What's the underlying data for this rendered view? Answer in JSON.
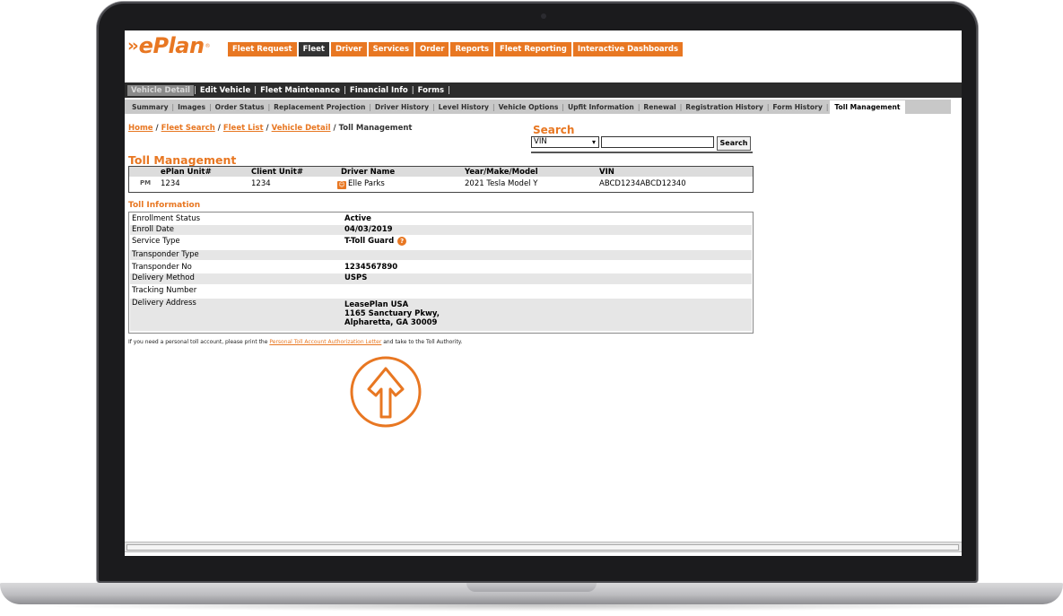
{
  "brand": {
    "chevrons": "››",
    "name": "ePlan",
    "mark": "®"
  },
  "top_nav": [
    {
      "label": "Fleet Request"
    },
    {
      "label": "Fleet"
    },
    {
      "label": "Driver"
    },
    {
      "label": "Services"
    },
    {
      "label": "Order"
    },
    {
      "label": "Reports"
    },
    {
      "label": "Fleet Reporting"
    },
    {
      "label": "Interactive Dashboards"
    }
  ],
  "top_nav_active": "Fleet",
  "sub_nav": [
    "Vehicle Detail",
    "Edit Vehicle",
    "Fleet Maintenance",
    "Financial Info",
    "Forms"
  ],
  "sub_nav_separator": "|",
  "tabs": [
    "Summary",
    "Images",
    "Order Status",
    "Replacement Projection",
    "Driver History",
    "Level History",
    "Vehicle Options",
    "Upfit Information",
    "Renewal",
    "Registration History",
    "Form History",
    "Toll Management"
  ],
  "breadcrumb": {
    "home": "Home",
    "fleet_search": "Fleet Search",
    "fleet_list": "Fleet List",
    "vehicle_detail": "Vehicle Detail",
    "current": "Toll Management",
    "sep": " / "
  },
  "search": {
    "title": "Search",
    "type_value": "VIN",
    "caret": "▾",
    "input_value": "",
    "button": "Search"
  },
  "toll_title": "Toll Management",
  "unit_table": {
    "headers": {
      "eplan_unit": "ePlan Unit#",
      "client_unit": "Client Unit#",
      "driver_name": "Driver Name",
      "ymm": "Year/Make/Model",
      "vin": "VIN"
    },
    "row": {
      "icon": "PM",
      "eplan_unit": "1234",
      "client_unit": "1234",
      "driver_name": "Elle Parks",
      "ymm": "2021 Tesla Model Y",
      "vin": "ABCD1234ABCD12340"
    }
  },
  "toll_info_title": "Toll Information",
  "toll_info": {
    "enrollment_status": {
      "label": "Enrollment Status",
      "value": "Active"
    },
    "enroll_date": {
      "label": "Enroll Date",
      "value": "04/03/2019"
    },
    "service_type": {
      "label": "Service Type",
      "value": "T-Toll Guard"
    },
    "transponder_type": {
      "label": "Transponder Type",
      "value": ""
    },
    "transponder_no": {
      "label": "Transponder No",
      "value": "1234567890"
    },
    "delivery_method": {
      "label": "Delivery Method",
      "value": "USPS"
    },
    "tracking_number": {
      "label": "Tracking Number",
      "value": ""
    },
    "delivery_address": {
      "label": "Delivery Address",
      "line1": "LeasePlan USA",
      "line2": "1165 Sanctuary Pkwy,",
      "line3": "Alpharetta, GA 30009"
    }
  },
  "help_glyph": "?",
  "note": {
    "before": "If you need a personal toll account, please print the ",
    "link": "Personal Toll Account Authorization Letter",
    "after": " and take to the Toll Authority."
  },
  "colors": {
    "accent": "#e87722",
    "nav_dark": "#2c2c2c",
    "tab_bar": "#c8c8c8",
    "row_shade": "#e6e6e6"
  },
  "icons": {
    "arrow": "up-arrow-circle-icon",
    "help": "question-circle-icon",
    "driver": "driver-icon",
    "unit": "pm-icon"
  }
}
